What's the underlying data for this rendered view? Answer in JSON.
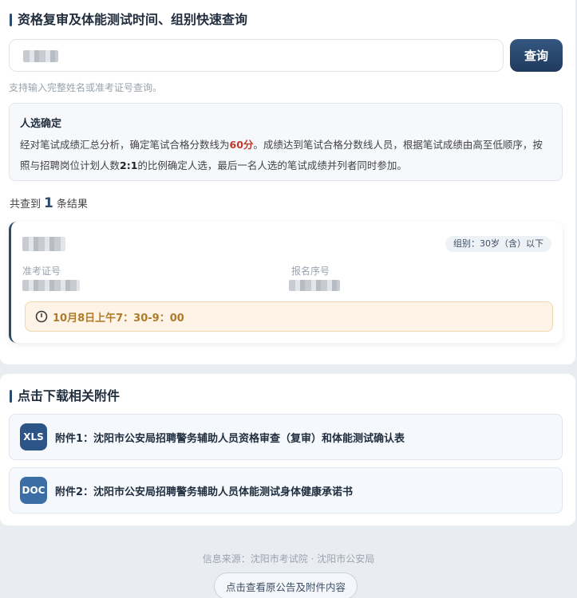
{
  "query": {
    "title": "资格复审及体能测试时间、组别快速查询",
    "search_button": "查询",
    "hint": "支持输入完整姓名或准考证号查询。"
  },
  "notice": {
    "title": "人选确定",
    "text_1": "经对笔试成绩汇总分析，确定笔试合格分数线为",
    "pass_score": "60分",
    "text_2": "。成绩达到笔试合格分数线人员，根据笔试成绩由高至低顺序，按照与招聘岗位计划人数",
    "ratio": "2:1",
    "text_3": "的比例确定人选，最后一名人选的笔试成绩并列者同时参加。"
  },
  "results": {
    "prefix": "共查到",
    "count": "1",
    "suffix": "条结果",
    "item": {
      "group_badge": "组别：30岁（含）以下",
      "ticket_label": "准考证号",
      "serial_label": "报名序号",
      "time": "10月8日上午7：30-9：00"
    }
  },
  "attachments": {
    "title": "点击下载相关附件",
    "items": [
      {
        "type": "XLS",
        "label": "附件1：沈阳市公安局招聘警务辅助人员资格审查（复审）和体能测试确认表"
      },
      {
        "type": "DOC",
        "label": "附件2：沈阳市公安局招聘警务辅助人员体能测试身体健康承诺书"
      }
    ]
  },
  "footer": {
    "source": "信息来源：沈阳市考试院 · 沈阳市公安局",
    "view_original": "点击查看原公告及附件内容"
  }
}
